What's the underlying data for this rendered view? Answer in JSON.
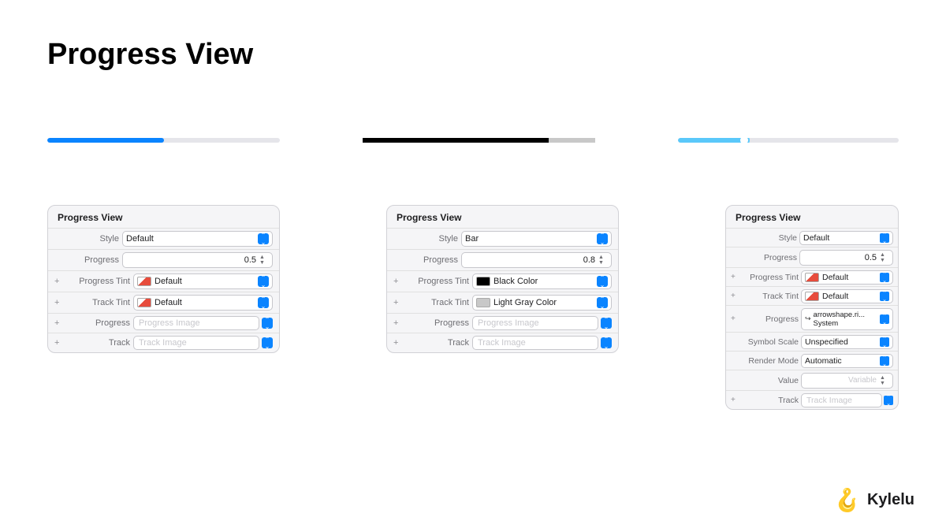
{
  "page": {
    "title": "Progress View"
  },
  "panel1": {
    "title": "Progress View",
    "rows": [
      {
        "label": "Style",
        "type": "select",
        "value": "Default",
        "plus": false
      },
      {
        "label": "Progress",
        "type": "number",
        "value": "0.5",
        "plus": false
      },
      {
        "label": "Progress Tint",
        "type": "color-select",
        "color": "red",
        "value": "Default",
        "plus": true
      },
      {
        "label": "Track Tint",
        "type": "color-select",
        "color": "red",
        "value": "Default",
        "plus": true
      },
      {
        "label": "Progress",
        "type": "ghost",
        "value": "Progress Image",
        "plus": true
      },
      {
        "label": "Track",
        "type": "ghost",
        "value": "Track Image",
        "plus": true
      }
    ]
  },
  "panel2": {
    "title": "Progress View",
    "rows": [
      {
        "label": "Style",
        "type": "select",
        "value": "Bar",
        "plus": false
      },
      {
        "label": "Progress",
        "type": "number",
        "value": "0.8",
        "plus": false
      },
      {
        "label": "Progress Tint",
        "type": "color-select",
        "color": "black",
        "value": "Black Color",
        "plus": true
      },
      {
        "label": "Track Tint",
        "type": "color-select",
        "color": "lightgray",
        "value": "Light Gray Color",
        "plus": true
      },
      {
        "label": "Progress",
        "type": "ghost",
        "value": "Progress Image",
        "plus": true
      },
      {
        "label": "Track",
        "type": "ghost",
        "value": "Track Image",
        "plus": true
      }
    ]
  },
  "panel3": {
    "title": "Progress View",
    "rows": [
      {
        "label": "Style",
        "type": "select",
        "value": "Default",
        "plus": false
      },
      {
        "label": "Progress",
        "type": "number",
        "value": "0.5",
        "plus": false
      },
      {
        "label": "Progress Tint",
        "type": "color-select",
        "color": "red",
        "value": "Default",
        "plus": true
      },
      {
        "label": "Track Tint",
        "type": "color-select",
        "color": "red",
        "value": "Default",
        "plus": true
      },
      {
        "label": "Progress",
        "type": "select-text",
        "value": "arrowshape.ri... System",
        "plus": true
      },
      {
        "label": "Symbol Scale",
        "type": "select",
        "value": "Unspecified",
        "plus": false
      },
      {
        "label": "Render Mode",
        "type": "select",
        "value": "Automatic",
        "plus": false
      },
      {
        "label": "Value",
        "type": "ghost-right",
        "value": "Variable",
        "plus": false
      },
      {
        "label": "Track",
        "type": "ghost",
        "value": "Track Image",
        "plus": true
      }
    ]
  },
  "kylelu": {
    "icon": "🪝",
    "label": "Kylelu"
  }
}
